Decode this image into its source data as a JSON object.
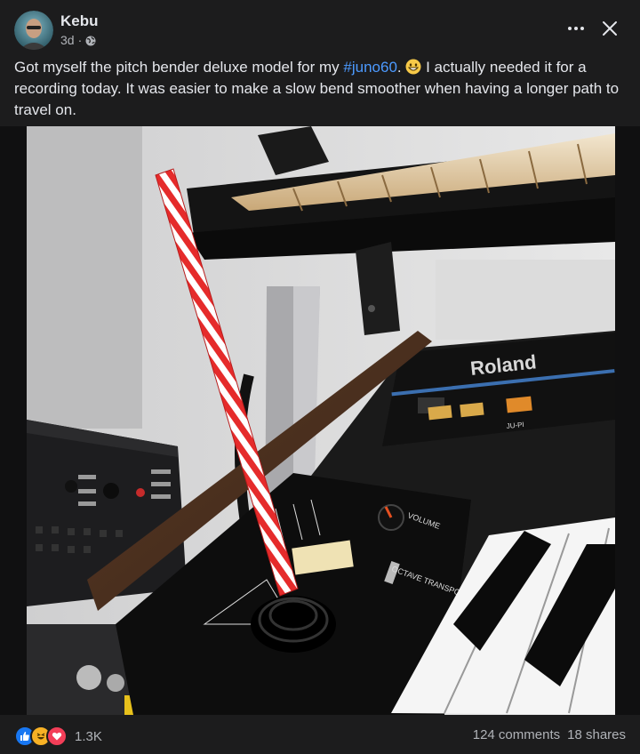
{
  "post": {
    "author": "Kebu",
    "time": "3d",
    "separator": "·",
    "privacy_icon": "globe-icon",
    "text_before": "Got myself the pitch bender deluxe model for my ",
    "hashtag": "#juno60",
    "text_after_hashtag": ". ",
    "text_after_emoji": " I actually needed it for a recording today. It was easier to make a slow bend smoother when having a longer path to travel on.",
    "emoji_icon": "grinning-face-emoji",
    "photo_icon": "synthesizer-photo",
    "photo_brand_text": "Roland",
    "photo_labels": [
      "VOLUME",
      "OCTAVE TRANSPOSE",
      "JU-PI"
    ]
  },
  "footer": {
    "reaction_icons": [
      "like-icon",
      "haha-icon",
      "love-icon"
    ],
    "reaction_count": "1.3K",
    "comments": "124 comments",
    "shares": "18 shares"
  },
  "colors": {
    "background": "#1c1c1d",
    "text": "#e4e6eb",
    "secondary_text": "#b0b3b8",
    "hashtag": "#4c9aff",
    "like": "#1877f2",
    "haha": "#f7b125",
    "love": "#f33e58"
  }
}
